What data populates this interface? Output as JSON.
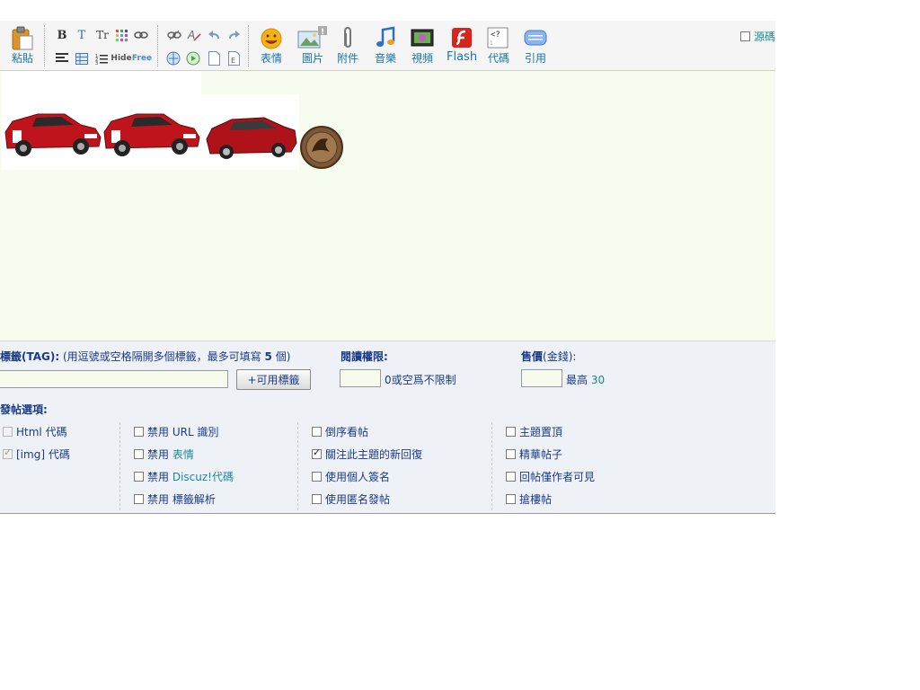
{
  "toolbar": {
    "paste_label": "粘貼",
    "small_top": [
      "B",
      "T",
      "Tr"
    ],
    "small_bottom": [
      "Hide",
      "Free"
    ],
    "big_buttons": [
      {
        "label": "表情",
        "icon": "smiley-icon"
      },
      {
        "label": "圖片",
        "icon": "picture-icon"
      },
      {
        "label": "附件",
        "icon": "paperclip-icon"
      },
      {
        "label": "音樂",
        "icon": "music-note-icon"
      },
      {
        "label": "視頻",
        "icon": "video-icon"
      },
      {
        "label": "Flash",
        "icon": "flash-icon"
      },
      {
        "label": "代碼",
        "icon": "code-icon"
      },
      {
        "label": "引用",
        "icon": "quote-icon"
      }
    ],
    "code_glyph": "<?",
    "source_label": "源碼"
  },
  "options": {
    "tag_label": "標籤(TAG):",
    "tag_hint_prefix": "(用逗號或空格隔開多個標籤，最多可填寫",
    "tag_hint_count": "5",
    "tag_hint_suffix": "個)",
    "tag_input_value": "",
    "tag_button": "+可用標籤",
    "read_perm_label": "閱讀權限:",
    "read_perm_hint": "0或空爲不限制",
    "price_label": "售價",
    "price_unit": "(金錢):",
    "price_hint_prefix": "最高",
    "price_hint_value": "30",
    "post_options_label": "發帖選項:",
    "col1": [
      {
        "label": "Html 代碼",
        "checked": false,
        "disabled": true
      },
      {
        "label": "[img] 代碼",
        "checked": true,
        "disabled": true
      }
    ],
    "col2": [
      {
        "prefix": "禁用",
        "label": "URL 識別",
        "checked": false
      },
      {
        "prefix": "禁用",
        "label": "表情",
        "checked": false
      },
      {
        "prefix": "禁用",
        "label": "Discuz!代碼",
        "checked": false
      },
      {
        "prefix": "禁用",
        "label": "標籤解析",
        "checked": false
      }
    ],
    "col3": [
      {
        "label": "倒序看帖",
        "checked": false
      },
      {
        "label": "關注此主題的新回復",
        "checked": true
      },
      {
        "label": "使用個人簽名",
        "checked": false
      },
      {
        "label": "使用匿名發帖",
        "checked": false
      }
    ],
    "col4": [
      {
        "label": "主題置頂",
        "checked": false
      },
      {
        "label": "精華帖子",
        "checked": false
      },
      {
        "label": "回帖僅作者可見",
        "checked": false
      },
      {
        "label": "搶樓帖",
        "checked": false
      }
    ]
  },
  "colors": {
    "link": "#1a76a8",
    "label": "#1b3a86",
    "editor_bg": "#f6fdee",
    "options_bg": "#eef2f7",
    "car_red": "#b8141c"
  }
}
